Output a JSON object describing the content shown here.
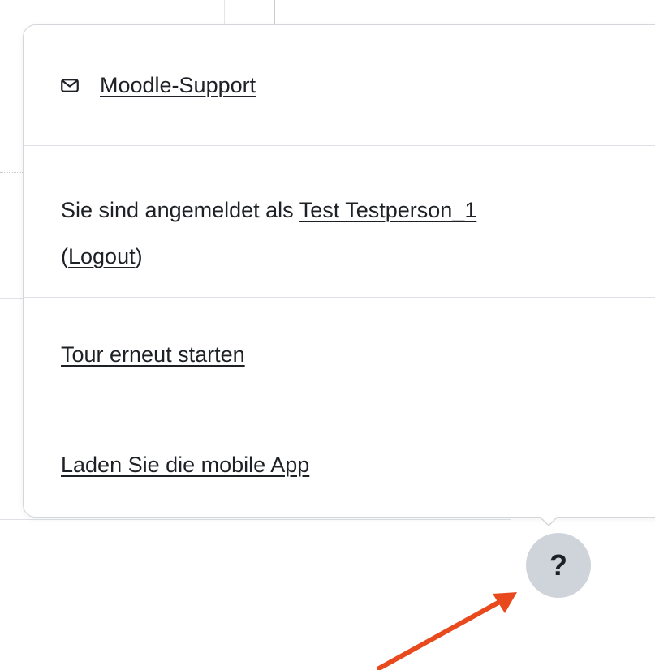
{
  "popover": {
    "support": {
      "icon": "envelope-icon",
      "label": "Moodle-Support"
    },
    "login": {
      "prefix": "Sie sind angemeldet als ",
      "user_name": "Test Testperson_1",
      "open_paren": "(",
      "logout_label": "Logout",
      "close_paren": ")"
    },
    "tour_label": "Tour erneut starten",
    "app_label": "Laden Sie die mobile App"
  },
  "help_button": {
    "label": "?",
    "icon": "question-mark-icon"
  },
  "annotation": {
    "icon": "red-arrow-icon",
    "color": "#e8491d"
  }
}
